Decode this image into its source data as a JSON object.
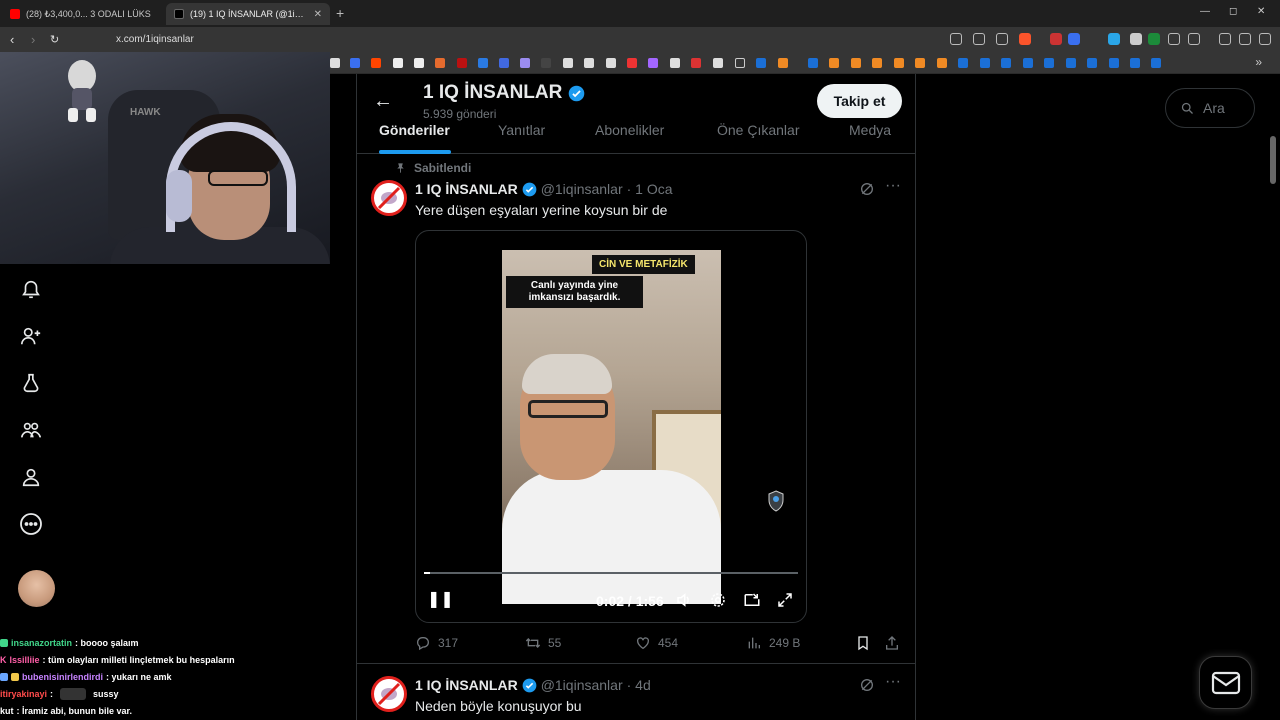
{
  "browser": {
    "tabs": [
      {
        "title": "(28) ₺3,400,0... 3 ODALI LÜKS",
        "active": false
      },
      {
        "title": "(19) 1 IQ İNSANLAR (@1iqinsa",
        "active": true
      }
    ],
    "new_tab": "+",
    "url": "x.com/1iqinsanlar",
    "close_glyph": "✕",
    "window_controls": {
      "minimize": "—",
      "maximize": "◻",
      "close": "✕"
    },
    "more": "»"
  },
  "webcam": {
    "chair_brand": "HAWK"
  },
  "chat": [
    {
      "user": "insanazortatin",
      "message": ": boooo şalaım",
      "color": "#41d68a"
    },
    {
      "user": "lssilliie",
      "message": ": tüm olayları milleti linçletmek bu hespaların",
      "color": "#ff5fa8"
    },
    {
      "user": "bubenisinirlendirdi",
      "message": ": yukarı ne amk",
      "color": "#c783ff"
    },
    {
      "user": "itiryakinayi",
      "message": ":",
      "emote": "sussy",
      "color": "#ff4b4b"
    },
    {
      "user": "kut",
      "message": ": İramiz abi, bunun bile var.",
      "color": "#ffffff"
    }
  ],
  "profile": {
    "name": "1 IQ İNSANLAR",
    "posts_count": "5.939 gönderi",
    "follow_label": "Takip et",
    "tabs": [
      "Gönderiler",
      "Yanıtlar",
      "Abonelikler",
      "Öne Çıkanlar",
      "Medya"
    ]
  },
  "pinned_label": "Sabitlendi",
  "posts": [
    {
      "name": "1 IQ İNSANLAR",
      "handle": "@1iqinsanlar",
      "date": "· 1 Oca",
      "text": "Yere düşen eşyaları yerine koysun bir de",
      "video": {
        "label_top": "CİN VE METAFİZİK",
        "label_caption": "Canlı yayında yine imkansızı başardık.",
        "time": "0:02 / 1:56",
        "progress": 0.017
      },
      "replies": "317",
      "reposts": "55",
      "likes": "454",
      "views": "249 B"
    },
    {
      "name": "1 IQ İNSANLAR",
      "handle": "@1iqinsanlar",
      "date": "· 4d",
      "text": "Neden böyle konuşuyor bu"
    }
  ],
  "search": {
    "placeholder": "Ara"
  },
  "colors": {
    "accent": "#1d9bf0",
    "background": "#000000",
    "muted": "#71767b",
    "text": "#e7e9ea"
  }
}
